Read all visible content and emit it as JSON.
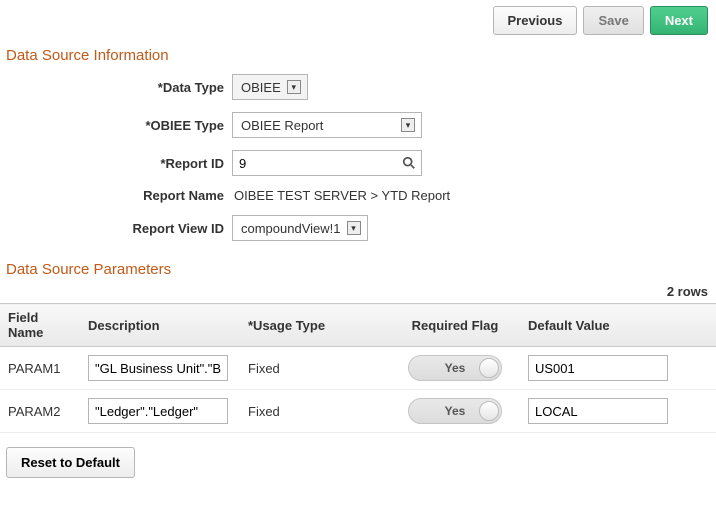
{
  "topbar": {
    "previous": "Previous",
    "save": "Save",
    "next": "Next"
  },
  "sections": {
    "info_title": "Data Source Information",
    "params_title": "Data Source Parameters"
  },
  "form": {
    "data_type": {
      "label": "*Data Type",
      "value": "OBIEE"
    },
    "obiee_type": {
      "label": "*OBIEE Type",
      "value": "OBIEE Report"
    },
    "report_id": {
      "label": "*Report ID",
      "value": "9"
    },
    "report_name": {
      "label": "Report Name",
      "value": "OIBEE TEST SERVER > YTD Report"
    },
    "report_view_id": {
      "label": "Report View ID",
      "value": "compoundView!1"
    }
  },
  "params": {
    "row_count_text": "2 rows",
    "headers": {
      "field_name": "Field Name",
      "description": "Description",
      "usage_type": "*Usage Type",
      "required_flag": "Required Flag",
      "default_value": "Default Value"
    },
    "rows": [
      {
        "field_name": "PARAM1",
        "description": "\"GL Business Unit\".\"Busi",
        "usage_type": "Fixed",
        "required_flag": "Yes",
        "default_value": "US001"
      },
      {
        "field_name": "PARAM2",
        "description": "\"Ledger\".\"Ledger\"",
        "usage_type": "Fixed",
        "required_flag": "Yes",
        "default_value": "LOCAL"
      }
    ]
  },
  "reset_label": "Reset to Default"
}
